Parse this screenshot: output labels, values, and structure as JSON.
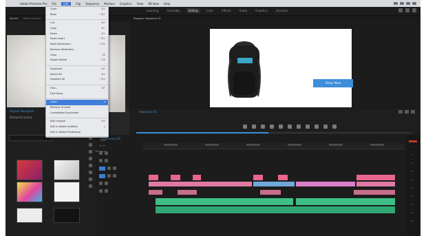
{
  "menubar": {
    "app": "Adobe Premiere Pro",
    "items": [
      "File",
      "Edit",
      "Clip",
      "Sequence",
      "Markers",
      "Graphics",
      "View",
      "Window",
      "Help"
    ],
    "active_item": "Edit"
  },
  "workspace_tabs": [
    "Learning",
    "Assembly",
    "Editing",
    "Color",
    "Effects",
    "Audio",
    "Graphics",
    "Libraries"
  ],
  "source_panel": {
    "tabs": [
      "Source",
      "Effect Controls",
      "Audio Clip Mixer",
      "Metadata"
    ]
  },
  "program_panel": {
    "tab": "Program: Sequence 01",
    "cta_label": "Shop Now"
  },
  "program_footer": {
    "tab": "Sequence 01"
  },
  "project_panel": {
    "title": "Project: Backpack",
    "bin": "Backpack.prproj"
  },
  "timeline": {
    "title": "Sequence 01"
  },
  "meters": {
    "labels": [
      "0",
      "-6",
      "-12",
      "-18",
      "-24",
      "-30",
      "-36",
      "-42",
      "-48",
      "-54"
    ]
  },
  "edit_menu": {
    "items": [
      {
        "label": "Undo",
        "shortcut": "⌘Z"
      },
      {
        "label": "Redo",
        "shortcut": "⇧⌘Z"
      },
      {
        "label": "Cut",
        "shortcut": "⌘X"
      },
      {
        "label": "Copy",
        "shortcut": "⌘C"
      },
      {
        "label": "Paste",
        "shortcut": "⌘V"
      },
      {
        "label": "Paste Insert",
        "shortcut": "⇧⌘V"
      },
      {
        "label": "Paste Attributes...",
        "shortcut": "⌥⌘V"
      },
      {
        "label": "Remove Attributes...",
        "shortcut": ""
      },
      {
        "label": "Clear",
        "shortcut": "⌫"
      },
      {
        "label": "Ripple Delete",
        "shortcut": "⇧⌫"
      },
      {
        "label": "Duplicate",
        "shortcut": "⇧⌘/"
      },
      {
        "label": "Select All",
        "shortcut": "⌘A"
      },
      {
        "label": "Deselect All",
        "shortcut": "⇧⌘A"
      },
      {
        "label": "Find...",
        "shortcut": "⌘F"
      },
      {
        "label": "Find Faces",
        "shortcut": ""
      },
      {
        "label": "Label",
        "shortcut": "▸"
      },
      {
        "label": "Remove Unused",
        "shortcut": ""
      },
      {
        "label": "Consolidate Duplicates",
        "shortcut": ""
      },
      {
        "label": "Edit Original",
        "shortcut": "⌘E"
      },
      {
        "label": "Edit in Adobe Audition",
        "shortcut": "▸"
      },
      {
        "label": "Edit in Adobe Photoshop",
        "shortcut": ""
      },
      {
        "label": "Keyboard Shortcuts...",
        "shortcut": "⌥⌘K"
      },
      {
        "label": "Start Dictation...",
        "shortcut": "fn fn"
      },
      {
        "label": "Emoji & Symbols",
        "shortcut": "^⌘Space"
      }
    ],
    "highlighted": "Label"
  }
}
